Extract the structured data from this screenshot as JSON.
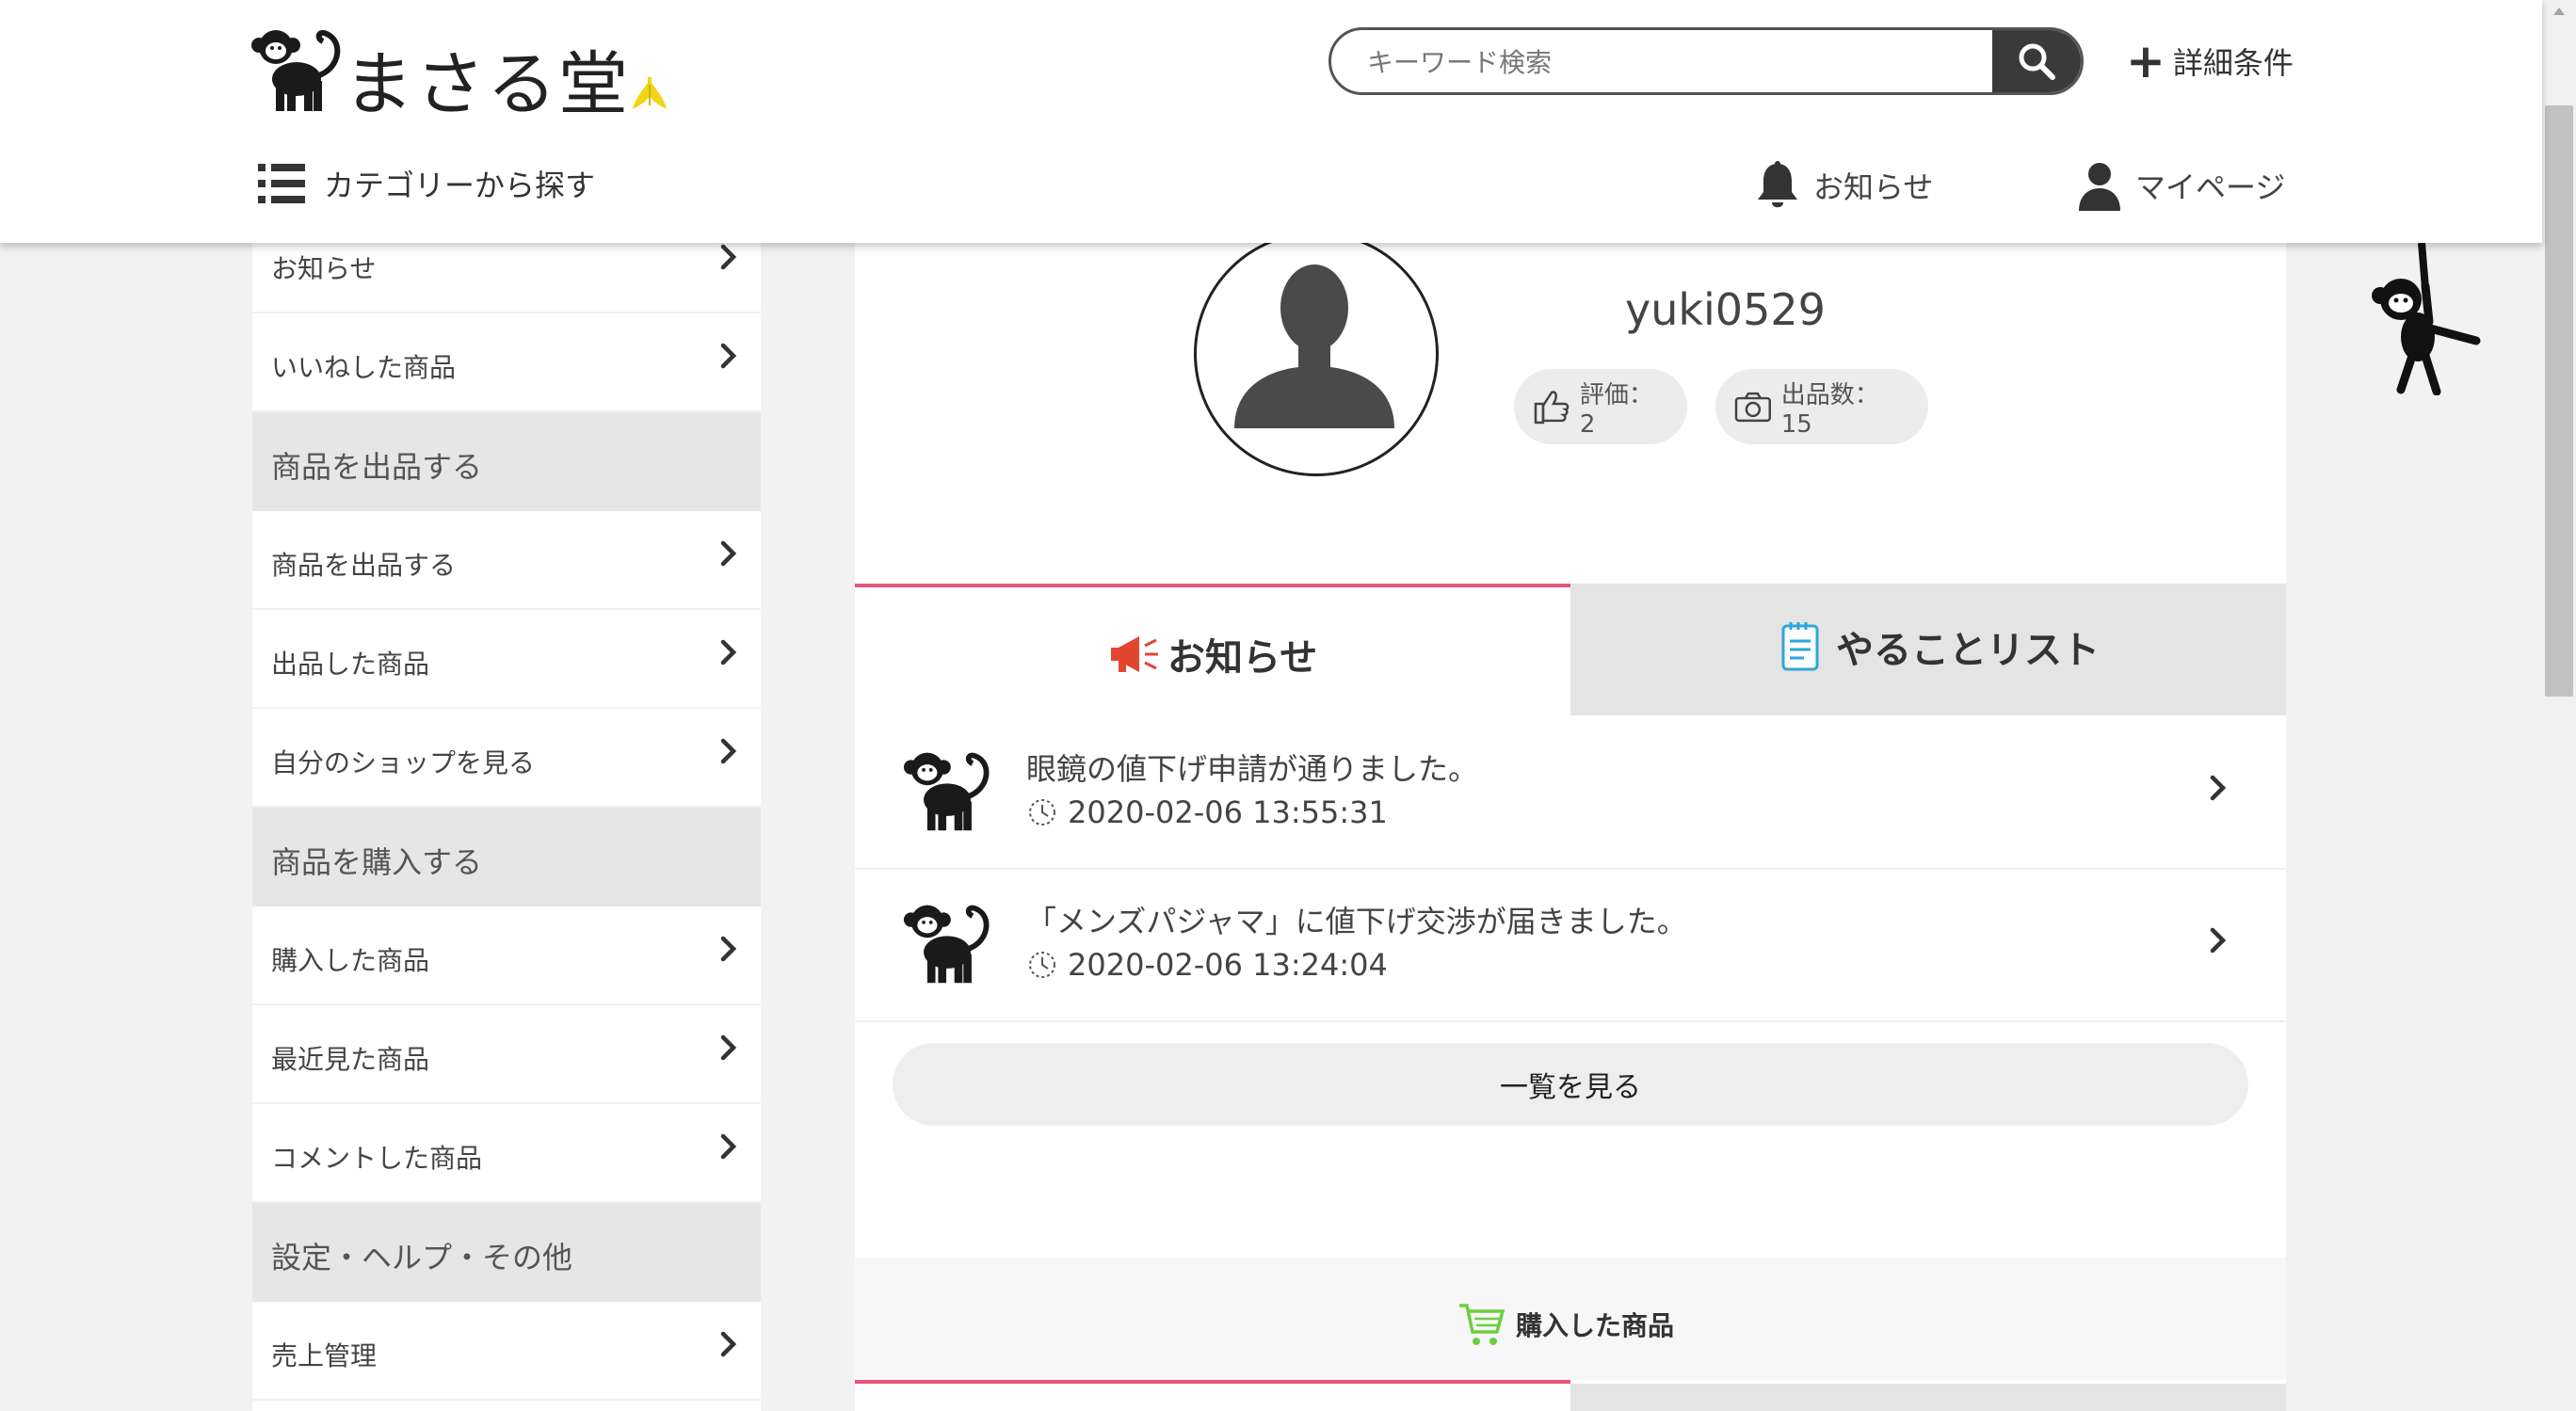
{
  "header": {
    "logo_text": "まさる堂",
    "search_placeholder": "キーワード検索",
    "advanced_search": "詳細条件",
    "category_nav": "カテゴリーから探す",
    "notifications": "お知らせ",
    "mypage": "マイページ"
  },
  "sidebar": {
    "items": [
      {
        "type": "item",
        "label": "お知らせ"
      },
      {
        "type": "item",
        "label": "いいねした商品"
      },
      {
        "type": "header",
        "label": "商品を出品する"
      },
      {
        "type": "item",
        "label": "商品を出品する"
      },
      {
        "type": "item",
        "label": "出品した商品"
      },
      {
        "type": "item",
        "label": "自分のショップを見る"
      },
      {
        "type": "header",
        "label": "商品を購入する"
      },
      {
        "type": "item",
        "label": "購入した商品"
      },
      {
        "type": "item",
        "label": "最近見た商品"
      },
      {
        "type": "item",
        "label": "コメントした商品"
      },
      {
        "type": "header",
        "label": "設定・ヘルプ・その他"
      },
      {
        "type": "item",
        "label": "売上管理"
      }
    ]
  },
  "profile": {
    "username": "yuki0529",
    "rating": "評価：2",
    "listings": "出品数：15"
  },
  "tabs": {
    "notices": "お知らせ",
    "todo": "やることリスト"
  },
  "notices": [
    {
      "message": "眼鏡の値下げ申請が通りました。",
      "time": "2020-02-06 13:55:31"
    },
    {
      "message": "「メンズパジャマ」に値下げ交渉が届きました。",
      "time": "2020-02-06 13:24:04"
    }
  ],
  "see_all": "一覧を見る",
  "purchased_section": "購入した商品",
  "colors": {
    "accent_pink": "#e8547a",
    "megaphone_red": "#e2462f",
    "notepad_blue": "#2ea7d8",
    "cart_green": "#6ccf3f",
    "banana_yellow": "#f2d51a"
  }
}
